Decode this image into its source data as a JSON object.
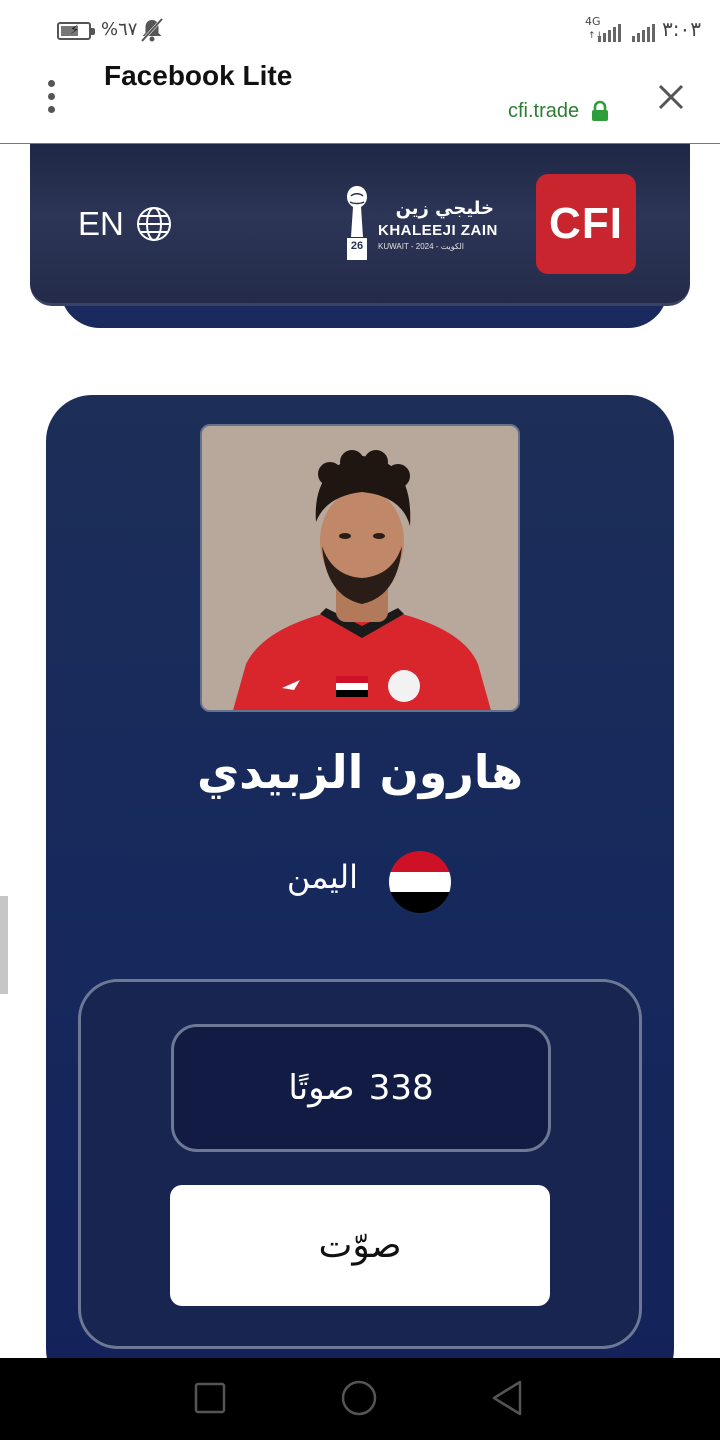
{
  "status_bar": {
    "battery_text": "%٦٧",
    "battery_level": 0.67,
    "network_label": "4G",
    "network_sub": "↑↓",
    "clock": "٣:٠٣",
    "icons": [
      "battery-charging-icon",
      "bell-off-icon",
      "signal-icon",
      "signal-icon"
    ]
  },
  "browser": {
    "title": "Facebook Lite",
    "url": "cfi.trade",
    "icons": [
      "menu-dots-icon",
      "lock-icon",
      "close-icon"
    ]
  },
  "site_header": {
    "language": "EN",
    "brand_left_ar": "خليجي زين",
    "brand_left_en": "KHALEEJI ZAIN",
    "brand_left_sub": "KUWAIT - 2024 - الكويت",
    "brand_left_badge": "26",
    "brand_right": "CFI",
    "icons": [
      "globe-icon",
      "khaleeji-zain-logo",
      "cfi-logo"
    ]
  },
  "player": {
    "name": "هارون الزبيدي",
    "country": "اليمن",
    "photo_alt": "player-photo"
  },
  "vote": {
    "count": "338",
    "count_unit": "صوتًا",
    "button_label": "صوّت"
  },
  "colors": {
    "card_bg": "#16295c",
    "banner_bg": "#2a3252",
    "cfi_red": "#c8252f",
    "secure_green": "#2e7d32",
    "flag_red": "#ce1126"
  },
  "nav_bar": {
    "icons": [
      "recent-apps-icon",
      "home-icon",
      "back-icon"
    ]
  }
}
